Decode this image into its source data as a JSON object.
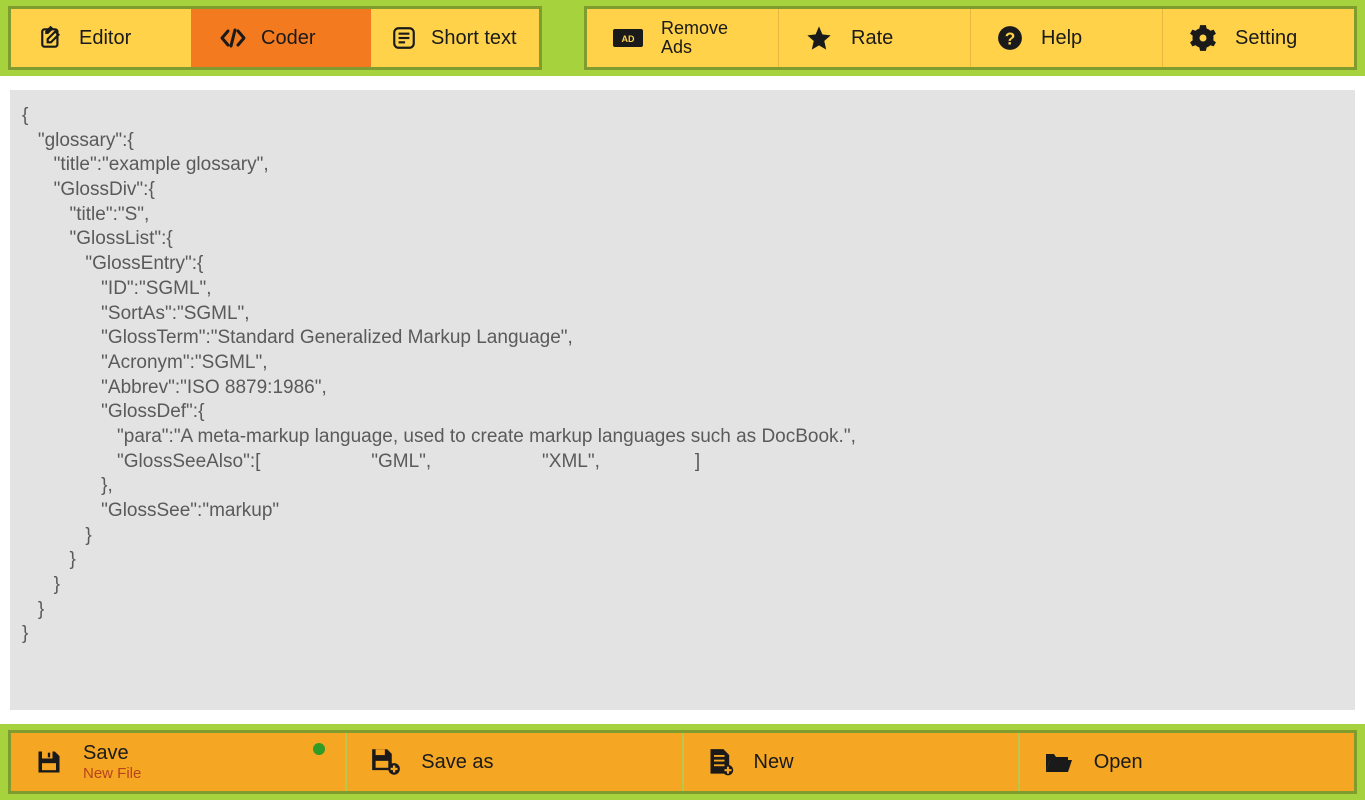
{
  "colors": {
    "accent_green": "#a6d23e",
    "yellow": "#ffd24a",
    "active_orange": "#f47a1f",
    "file_orange": "#f5a623",
    "code_bg": "#e3e3e3",
    "text_muted": "#5a5a5a",
    "sub_red": "#b6441d"
  },
  "tabs": {
    "editor": "Editor",
    "coder": "Coder",
    "short_text": "Short text",
    "active": "coder"
  },
  "menu": {
    "remove_ads_line1": "Remove",
    "remove_ads_line2": "Ads",
    "rate": "Rate",
    "help": "Help",
    "setting": "Setting"
  },
  "code_text": "{\n   \"glossary\":{\n      \"title\":\"example glossary\",\n      \"GlossDiv\":{\n         \"title\":\"S\",\n         \"GlossList\":{\n            \"GlossEntry\":{\n               \"ID\":\"SGML\",\n               \"SortAs\":\"SGML\",\n               \"GlossTerm\":\"Standard Generalized Markup Language\",\n               \"Acronym\":\"SGML\",\n               \"Abbrev\":\"ISO 8879:1986\",\n               \"GlossDef\":{\n                  \"para\":\"A meta-markup language, used to create markup languages such as DocBook.\",\n                  \"GlossSeeAlso\":[                     \"GML\",                     \"XML\",                  ]\n               },\n               \"GlossSee\":\"markup\"\n            }\n         }\n      }\n   }\n}",
  "file": {
    "save": "Save",
    "save_sub": "New File",
    "save_as": "Save as",
    "new": "New",
    "open": "Open",
    "dirty": true
  }
}
